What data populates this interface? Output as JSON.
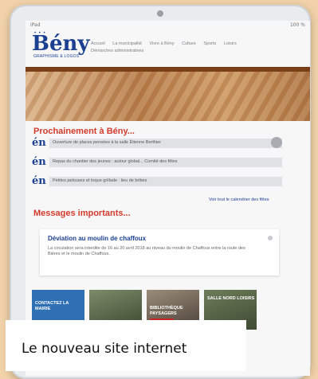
{
  "status": {
    "left": "iPad",
    "right": "100 %"
  },
  "logo": {
    "dots": "• • •",
    "text": "Bény",
    "sub": "GRAPHISME & LOGOS"
  },
  "nav": {
    "items": [
      "Accueil",
      "La municipalité",
      "Vivre à Bény",
      "Culture",
      "Sports",
      "Loisirs"
    ],
    "row2": [
      "Démarches administratives"
    ]
  },
  "section1": {
    "title": "Prochainement à Bény..."
  },
  "events": [
    {
      "icon": "én",
      "label": "Ouverture de places pensées à la salle Étienne Berthier"
    },
    {
      "icon": "én",
      "label": "Repas du chantier des jeunes : autour global... Comité des fêtes"
    },
    {
      "icon": "én",
      "label": "Petites pelouses et toque grillade : lieu de bribes"
    }
  ],
  "calendar_link": "Voir tout le calendrier des fêtes",
  "section2": {
    "title": "Messages importants..."
  },
  "message": {
    "title": "Déviation au moulin de chaffoux",
    "text": "La circulation sera interdite de 16 au 20 avril 2018 au niveau du moulin de Chaffoux entre la route des Bières et le moulin de Chaffoux."
  },
  "tiles": [
    {
      "caption": "CONTACTEZ LA MAIRIE"
    },
    {
      "caption": ""
    },
    {
      "caption": "BIBLIOTHÈQUE PAYSAGERS"
    },
    {
      "caption": "SALLE NORD LOISIRS"
    }
  ],
  "caption": {
    "text": "Le nouveau site internet"
  },
  "colors": {
    "accent": "#d33b2c",
    "brand": "#1b3f91",
    "background": "#f1d2a9"
  }
}
